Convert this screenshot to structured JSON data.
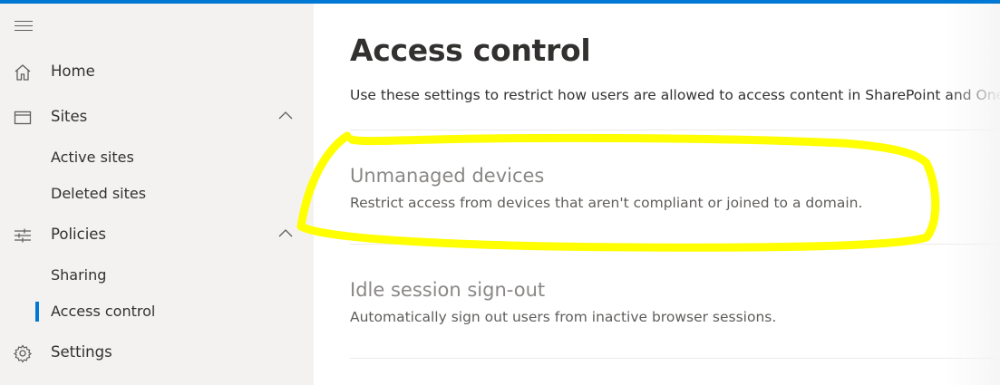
{
  "colors": {
    "accent": "#0078d4",
    "sidebar_bg": "#f3f2f1",
    "highlight": "#ffff00"
  },
  "sidebar": {
    "menu_icon": "hamburger-icon",
    "items": [
      {
        "label": "Home",
        "icon": "home-icon"
      },
      {
        "label": "Sites",
        "icon": "sites-icon",
        "expanded": true,
        "children": [
          {
            "label": "Active sites"
          },
          {
            "label": "Deleted sites"
          }
        ]
      },
      {
        "label": "Policies",
        "icon": "policies-icon",
        "expanded": true,
        "children": [
          {
            "label": "Sharing"
          },
          {
            "label": "Access control",
            "selected": true
          }
        ]
      },
      {
        "label": "Settings",
        "icon": "gear-icon"
      }
    ]
  },
  "main": {
    "title": "Access control",
    "description": "Use these settings to restrict how users are allowed to access content in SharePoint and OneD",
    "settings": [
      {
        "title": "Unmanaged devices",
        "description": "Restrict access from devices that aren't compliant or joined to a domain.",
        "highlighted": true
      },
      {
        "title": "Idle session sign-out",
        "description": "Automatically sign out users from inactive browser sessions."
      }
    ]
  }
}
